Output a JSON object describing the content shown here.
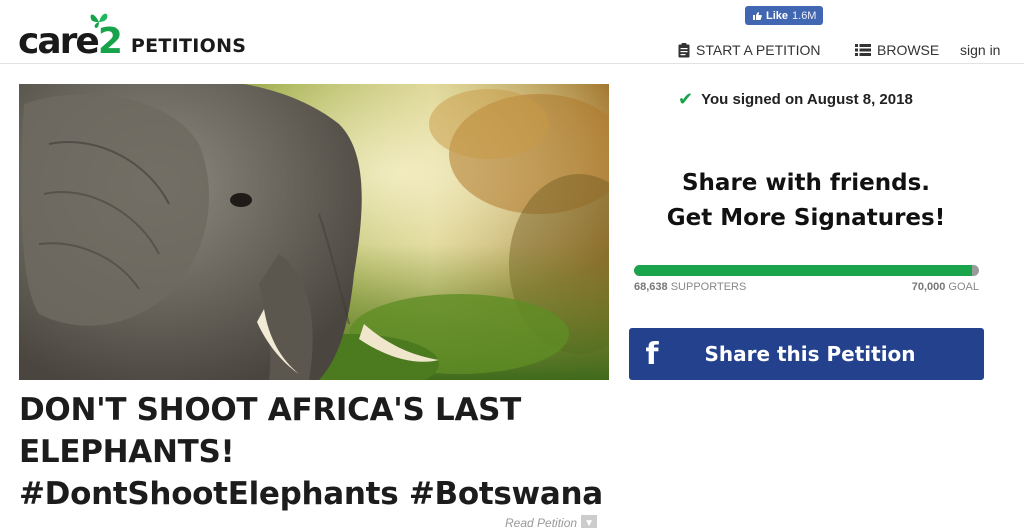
{
  "header": {
    "logo_word": "care",
    "logo_digit": "2",
    "logo_sub": "PETITIONS",
    "fb_like": {
      "label": "Like",
      "count": "1.6M"
    },
    "nav": {
      "start_label": "START A PETITION",
      "browse_label": "BROWSE",
      "signin_label": "sign in"
    }
  },
  "petition": {
    "title": "DON'T SHOOT AFRICA'S LAST ELEPHANTS! #DontShootElephants #Botswana",
    "read_label": "Read Petition"
  },
  "sidebar": {
    "signed_text": "You signed on August 8, 2018",
    "share_line1": "Share with friends.",
    "share_line2": "Get More Signatures!",
    "progress": {
      "fraction": 0.9806,
      "supporters_number": "68,638",
      "supporters_label": "SUPPORTERS",
      "goal_number": "70,000",
      "goal_label": "GOAL"
    },
    "fb_button_label": "Share this Petition"
  },
  "colors": {
    "brand_green": "#17a34a",
    "facebook_blue": "#23418c",
    "progress_green": "#1aa54c"
  },
  "icons": {
    "logo": "butterfly-icon",
    "start": "clipboard-icon",
    "browse": "list-icon",
    "signed": "checkmark-icon",
    "facebook": "facebook-icon",
    "read": "chevron-down-icon"
  }
}
